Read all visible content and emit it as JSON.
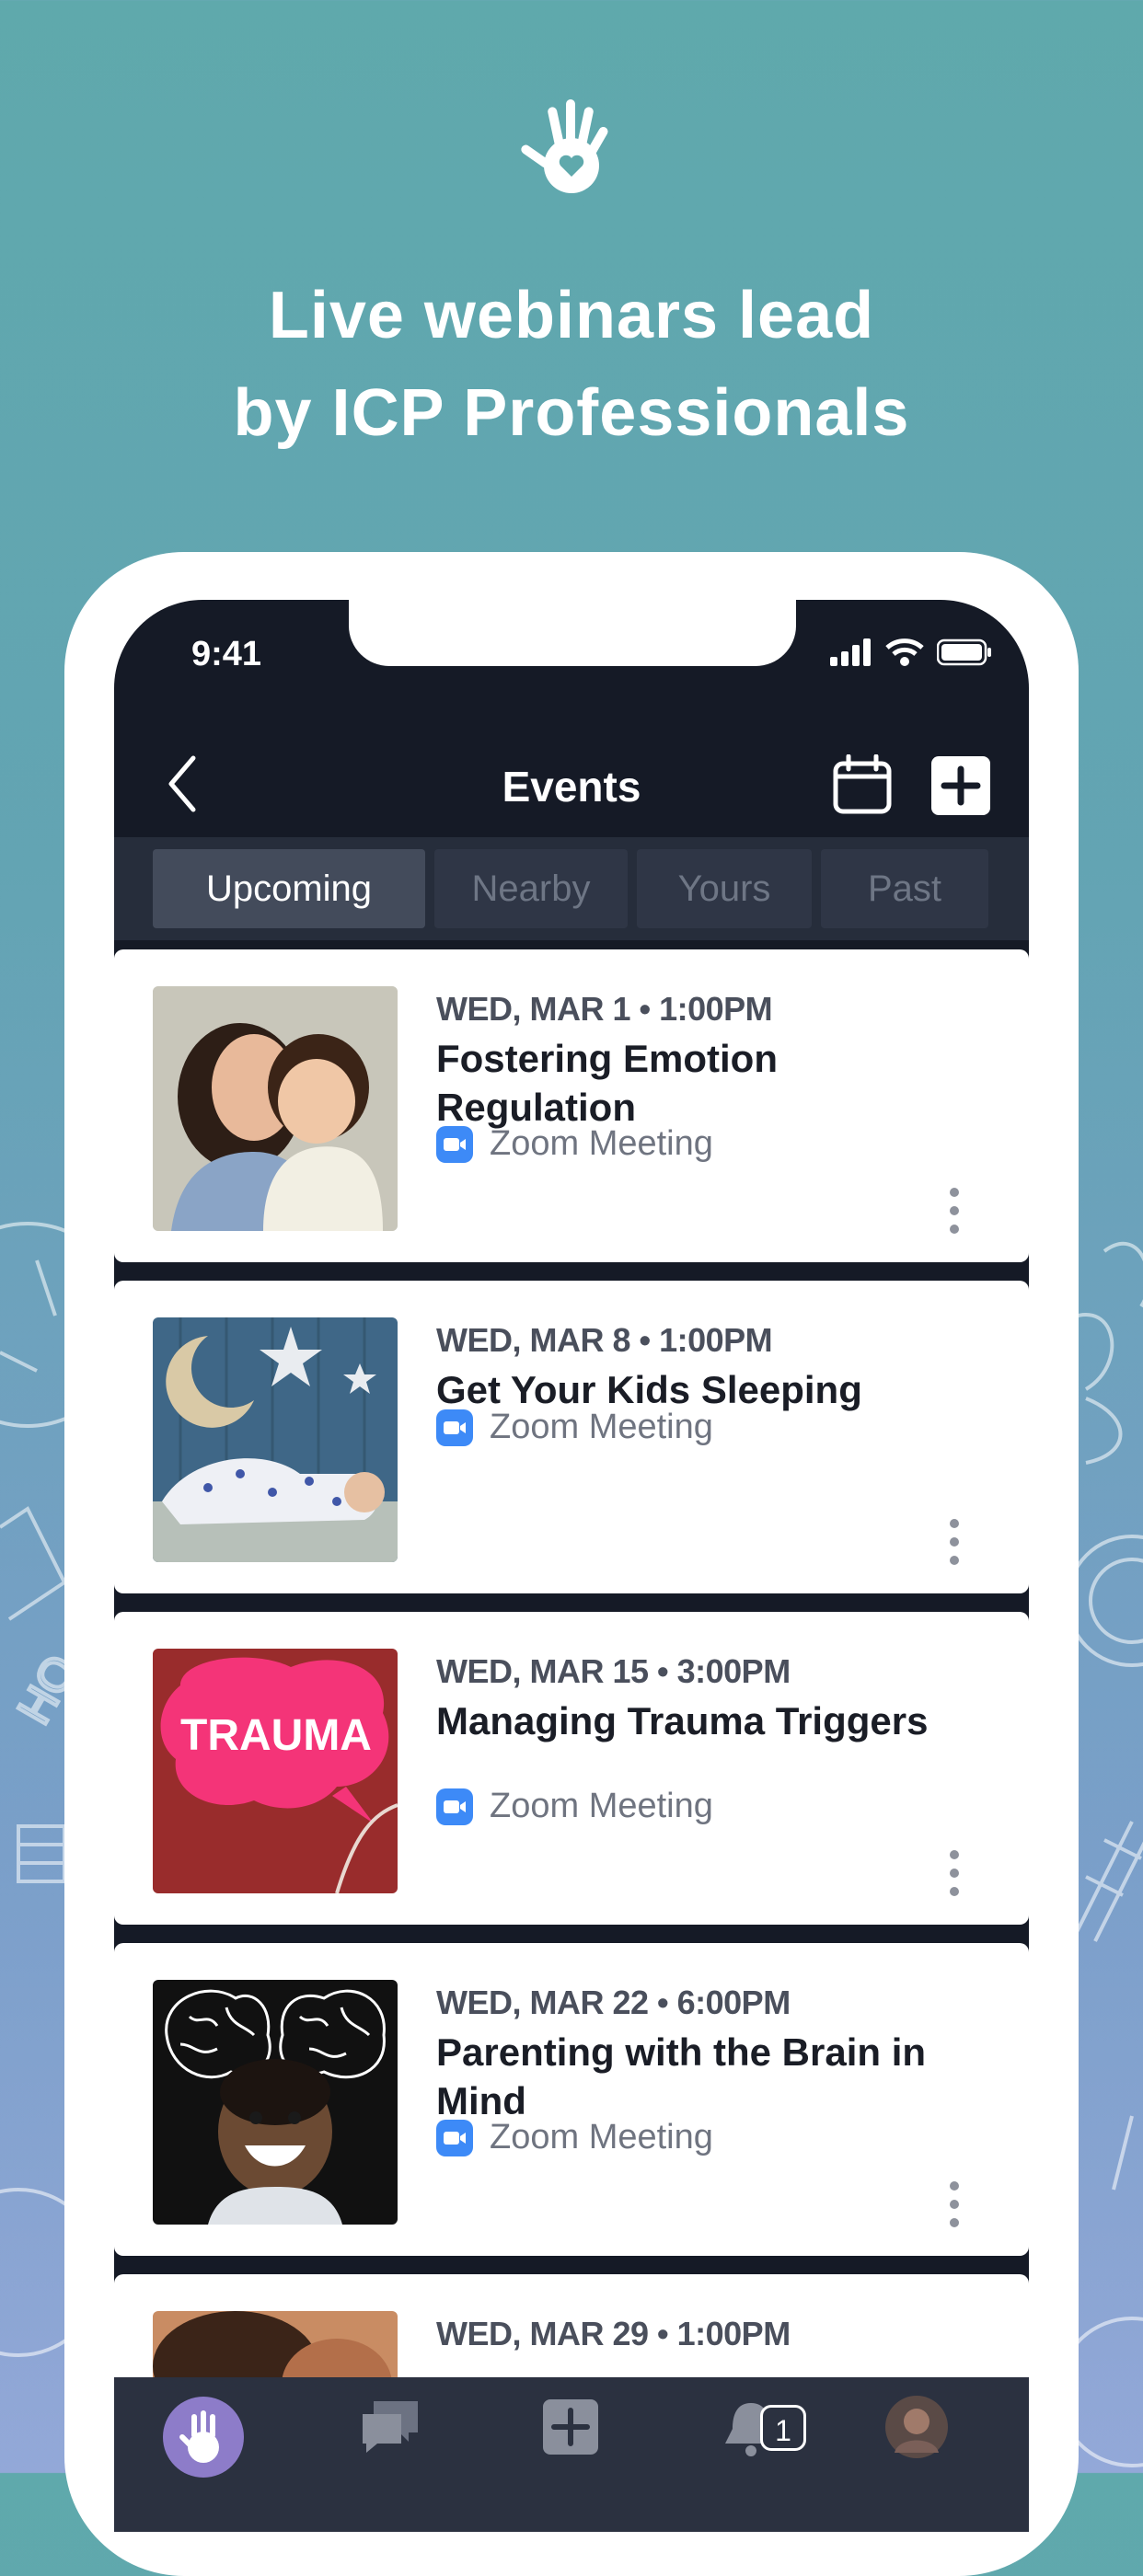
{
  "hero": {
    "headline_line1": "Live webinars lead",
    "headline_line2": "by ICP Professionals"
  },
  "status_bar": {
    "time": "9:41"
  },
  "nav": {
    "title": "Events"
  },
  "tabs": [
    {
      "label": "Upcoming",
      "active": true
    },
    {
      "label": "Nearby",
      "active": false
    },
    {
      "label": "Yours",
      "active": false
    },
    {
      "label": "Past",
      "active": false
    }
  ],
  "events": [
    {
      "date": "WED, MAR 1 • 1:00PM",
      "title": "Fostering Emotion Regulation",
      "location": "Zoom Meeting",
      "thumb": "mother-and-child"
    },
    {
      "date": "WED, MAR 8 • 1:00PM",
      "title": "Get Your Kids Sleeping",
      "location": "Zoom Meeting",
      "thumb": "sleeping-child"
    },
    {
      "date": "WED, MAR 15 • 3:00PM",
      "title": "Managing Trauma Triggers",
      "location": "Zoom Meeting",
      "thumb": "trauma-brain",
      "thumb_text": "TRAUMA"
    },
    {
      "date": "WED, MAR 22 • 6:00PM",
      "title": "Parenting with the Brain in Mind",
      "location": "Zoom Meeting",
      "thumb": "laughing-boy-brains"
    },
    {
      "date": "WED, MAR 29 • 1:00PM",
      "title": "",
      "location": "",
      "thumb": "partial"
    }
  ],
  "tab_bar": {
    "items": [
      "home-icon",
      "chat-icon",
      "add-icon",
      "notifications-icon",
      "profile-avatar"
    ],
    "notification_count": "1"
  },
  "colors": {
    "background_top": "#5fa9ac",
    "background_bottom": "#93a8d8",
    "app_dark": "#151a26",
    "zoom_blue": "#3d8af7"
  }
}
